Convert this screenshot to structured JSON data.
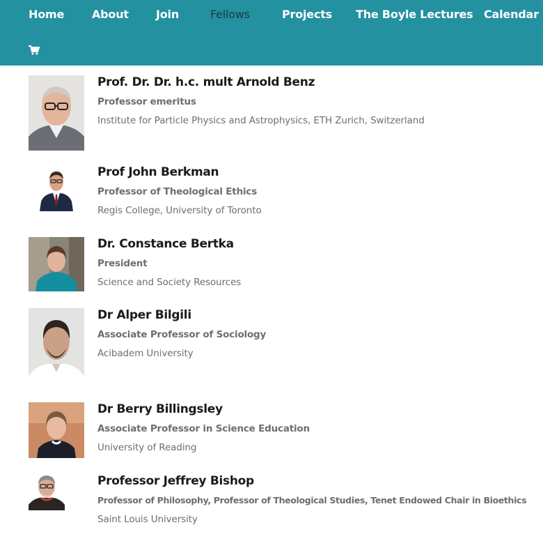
{
  "nav": {
    "items": [
      {
        "label": "Home",
        "active": false
      },
      {
        "label": "About",
        "active": false
      },
      {
        "label": "Join",
        "active": false
      },
      {
        "label": "Fellows",
        "active": true
      },
      {
        "label": "Projects",
        "active": false
      },
      {
        "label": "The Boyle Lectures",
        "active": false
      },
      {
        "label": "Calendar",
        "active": false
      }
    ],
    "cart_icon": "shopping-cart-icon"
  },
  "colors": {
    "nav_background": "#2391a0",
    "nav_text": "#ffffff",
    "nav_active_text": "#1d3a3f",
    "name_text": "#1a1a1a",
    "meta_text": "#6e6e6e"
  },
  "fellows": [
    {
      "name": "Prof. Dr. Dr. h.c. mult Arnold Benz",
      "role": "Professor emeritus",
      "institution": "Institute for Particle Physics and Astrophysics, ETH Zurich, Switzerland"
    },
    {
      "name": "Prof John Berkman",
      "role": "Professor of Theological Ethics",
      "institution": "Regis College, University of Toronto"
    },
    {
      "name": "Dr. Constance Bertka",
      "role": "President",
      "institution": "Science and Society Resources"
    },
    {
      "name": "Dr Alper Bilgili",
      "role": "Associate Professor of Sociology",
      "institution": "Acibadem University"
    },
    {
      "name": "Dr Berry Billingsley",
      "role": "Associate Professor in Science Education",
      "institution": "University of Reading"
    },
    {
      "name": "Professor Jeffrey Bishop",
      "role": "Professor of Philosophy, Professor of Theological Studies, Tenet Endowed Chair in Bioethics",
      "institution": "Saint Louis University"
    }
  ]
}
